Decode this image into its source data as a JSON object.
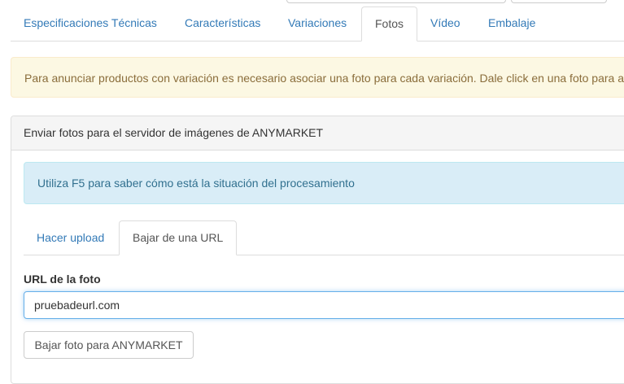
{
  "main_tabs": [
    {
      "label": "Especificaciones Técnicas"
    },
    {
      "label": "Características"
    },
    {
      "label": "Variaciones"
    },
    {
      "label": "Fotos",
      "active": true
    },
    {
      "label": "Vídeo"
    },
    {
      "label": "Embalaje"
    }
  ],
  "warning_alert": {
    "text": "Para anunciar productos con variación es necesario asociar una foto para cada variación. Dale click en una foto para a"
  },
  "panel": {
    "heading": "Enviar fotos para el servidor de imágenes de ANYMARKET",
    "info_alert": "Utiliza F5 para saber cómo está la situación del procesamiento",
    "sub_tabs": [
      {
        "label": "Hacer upload"
      },
      {
        "label": "Bajar de una URL",
        "active": true
      }
    ],
    "url_label": "URL de la foto",
    "url_value": "pruebadeurl.com",
    "download_button": "Bajar foto para ANYMARKET"
  },
  "colors": {
    "link": "#337ab7",
    "warning_bg": "#fcf8e3",
    "info_bg": "#d9edf7",
    "focus_border": "#66afe9"
  }
}
